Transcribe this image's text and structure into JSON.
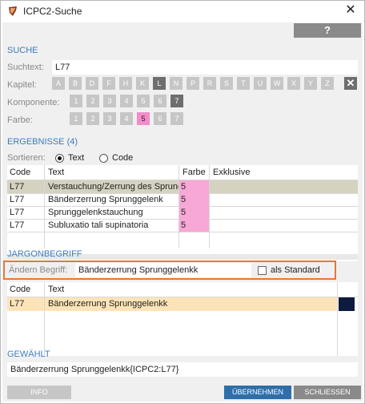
{
  "window": {
    "title": "ICPC2-Suche",
    "help_label": "?"
  },
  "suche": {
    "section_label": "SUCHE",
    "suchtext_label": "Suchtext:",
    "suchtext_value": "L77",
    "kapitel_label": "Kapitel:",
    "kapitel": [
      "A",
      "B",
      "D",
      "F",
      "H",
      "K",
      "L",
      "N",
      "P",
      "R",
      "S",
      "T",
      "U",
      "W",
      "X",
      "Y",
      "Z"
    ],
    "kapitel_active": "L",
    "komponente_label": "Komponente:",
    "komponente": [
      "1",
      "2",
      "3",
      "4",
      "5",
      "6",
      "7"
    ],
    "komponente_active": "7",
    "farbe_label": "Farbe:",
    "farbe": [
      "1",
      "2",
      "3",
      "4",
      "5",
      "6",
      "7"
    ],
    "farbe_active": "5"
  },
  "ergebnisse": {
    "section_label": "ERGEBNISSE (4)",
    "sort_label": "Sortieren:",
    "sort_options": [
      "Text",
      "Code"
    ],
    "sort_selected": "Text",
    "columns": [
      "Code",
      "Text",
      "Farbe",
      "Exklusive"
    ],
    "rows": [
      {
        "code": "L77",
        "text": "Verstauchung/Zerrung des Sprunggelenks",
        "farbe": "5",
        "exklusive": ""
      },
      {
        "code": "L77",
        "text": "Bänderzerrung Sprunggelenk",
        "farbe": "5",
        "exklusive": ""
      },
      {
        "code": "L77",
        "text": "Sprunggelenkstauchung",
        "farbe": "5",
        "exklusive": ""
      },
      {
        "code": "L77",
        "text": "Subluxatio tali supinatoria",
        "farbe": "5",
        "exklusive": ""
      }
    ]
  },
  "jargon": {
    "section_label": "JARGONBEGRIFF",
    "aendern_label": "Ändern Begriff:",
    "aendern_value": "Bänderzerrung Sprunggelenkk",
    "standard_label": "als Standard",
    "columns": [
      "Code",
      "Text"
    ],
    "rows": [
      {
        "code": "L77",
        "text": "Bänderzerrung Sprunggelenkk"
      }
    ]
  },
  "gewaehlt": {
    "section_label": "GEWÄHLT",
    "value": "Bänderzerrung Sprunggelenkk{ICPC2:L77}"
  },
  "buttons": {
    "info": "INFO",
    "uebernehmen": "ÜBERNEHMEN",
    "schliessen": "SCHLIESSEN"
  },
  "colors": {
    "accent": "#3a7bbf",
    "highlight_row": "#fde4b8",
    "selected_row": "#d6d2c0",
    "pink": "#f7a8d6",
    "focus_border": "#e07a3a"
  }
}
